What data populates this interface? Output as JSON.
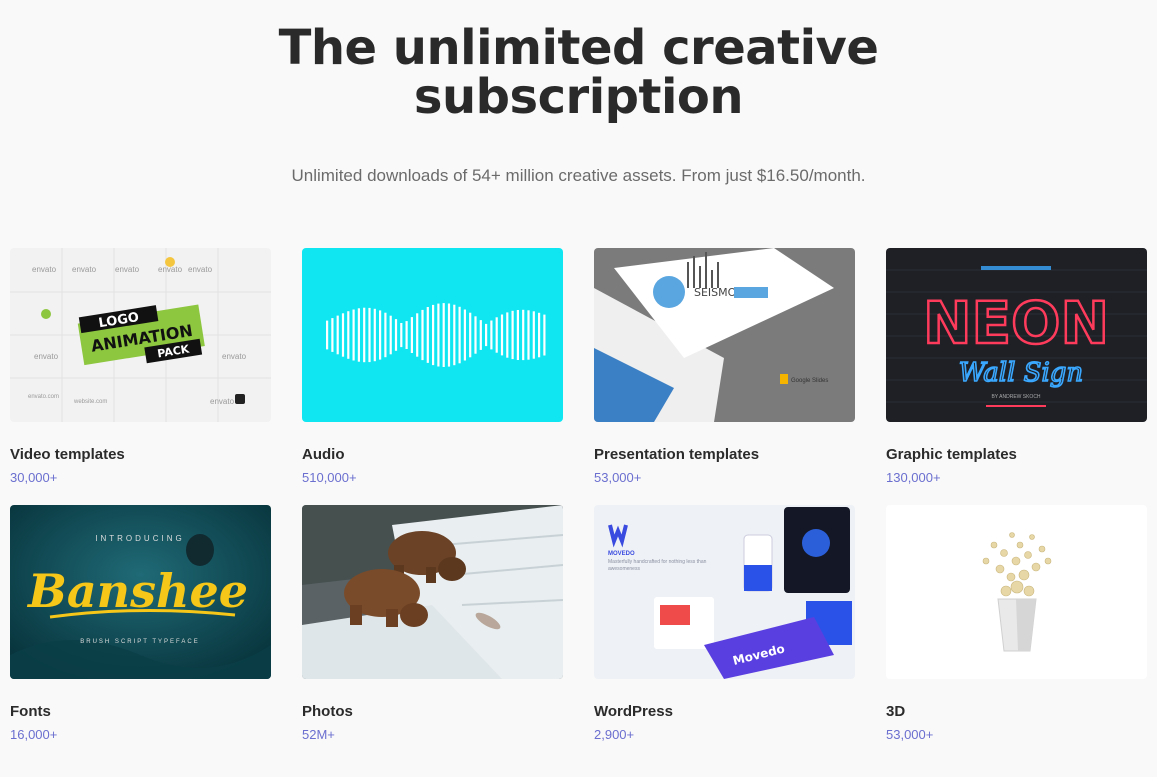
{
  "hero": {
    "title_line1": "The unlimited creative",
    "title_line2": "subscription",
    "subtitle": "Unlimited downloads of 54+ million creative assets. From just $16.50/month."
  },
  "categories": [
    {
      "title": "Video templates",
      "count": "30,000+",
      "thumb_text": [
        "LOGO",
        "ANIMATION",
        "PACK",
        "envato",
        "envato.com",
        "website.com"
      ]
    },
    {
      "title": "Audio",
      "count": "510,000+"
    },
    {
      "title": "Presentation templates",
      "count": "53,000+",
      "thumb_text": [
        "SEISMO",
        "Google Slides"
      ]
    },
    {
      "title": "Graphic templates",
      "count": "130,000+",
      "thumb_text": [
        "NEON",
        "Wall Sign",
        "BY ANDREW SKOCH"
      ]
    },
    {
      "title": "Fonts",
      "count": "16,000+",
      "thumb_text": [
        "INTRODUCING",
        "Banshee",
        "BRUSH SCRIPT TYPEFACE"
      ]
    },
    {
      "title": "Photos",
      "count": "52M+"
    },
    {
      "title": "WordPress",
      "count": "2,900+",
      "thumb_text": [
        "MOVEDO",
        "Masterfully handcrafted for nothing less than awesomeness",
        "Movedo"
      ]
    },
    {
      "title": "3D",
      "count": "53,000+"
    }
  ],
  "colors": {
    "accent_count": "#6b6fcf",
    "audio_bg": "#0fe6f2",
    "neon_pink": "#ff3b5c",
    "neon_blue": "#3aa8ff",
    "font_yellow": "#f6c619"
  }
}
